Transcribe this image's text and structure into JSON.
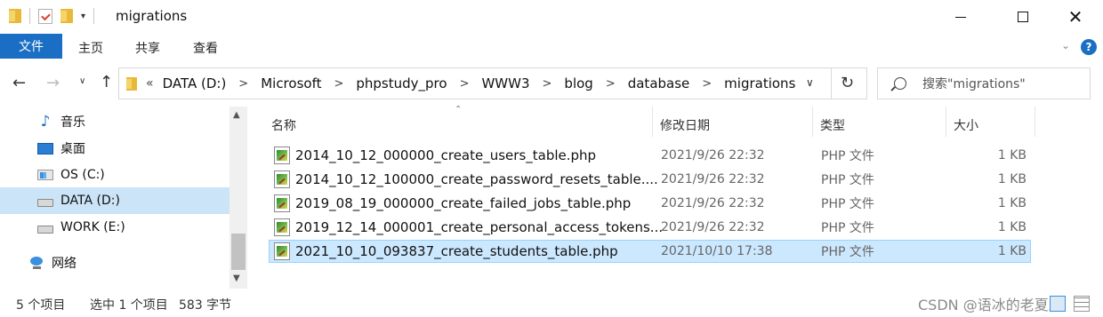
{
  "window": {
    "title": "migrations",
    "qat_dropdown": "▾",
    "minimize": "",
    "maximize": "",
    "close": "✕"
  },
  "ribbon": {
    "tabs": [
      {
        "label": "文件"
      },
      {
        "label": "主页"
      },
      {
        "label": "共享"
      },
      {
        "label": "查看"
      }
    ],
    "expand": "⌄",
    "help": "?"
  },
  "nav": {
    "back": "←",
    "forward": "→",
    "recent": "∨",
    "up": "↑",
    "overflow": "«",
    "breadcrumbs": [
      "DATA (D:)",
      "Microsoft",
      "phpstudy_pro",
      "WWW3",
      "blog",
      "database",
      "migrations"
    ],
    "separator": ">",
    "dropdown": "∨",
    "refresh": "↻",
    "search_placeholder": "搜索\"migrations\""
  },
  "sidebar": {
    "items": [
      {
        "label": "音乐",
        "icon": "music-note-icon",
        "selected": false
      },
      {
        "label": "桌面",
        "icon": "desktop-icon",
        "selected": false
      },
      {
        "label": "OS (C:)",
        "icon": "os-drive-icon",
        "selected": false
      },
      {
        "label": "DATA (D:)",
        "icon": "drive-icon",
        "selected": true
      },
      {
        "label": "WORK (E:)",
        "icon": "drive-icon",
        "selected": false
      },
      {
        "label": "网络",
        "icon": "network-icon",
        "selected": false
      }
    ],
    "scroll_up": "▲",
    "scroll_down": "▼"
  },
  "filelist": {
    "sort_indicator": "⌃",
    "columns": {
      "name": "名称",
      "date": "修改日期",
      "type": "类型",
      "size": "大小"
    },
    "rows": [
      {
        "name": "2014_10_12_000000_create_users_table.php",
        "date": "2021/9/26 22:32",
        "type": "PHP 文件",
        "size": "1 KB",
        "selected": false
      },
      {
        "name": "2014_10_12_100000_create_password_resets_table....",
        "date": "2021/9/26 22:32",
        "type": "PHP 文件",
        "size": "1 KB",
        "selected": false
      },
      {
        "name": "2019_08_19_000000_create_failed_jobs_table.php",
        "date": "2021/9/26 22:32",
        "type": "PHP 文件",
        "size": "1 KB",
        "selected": false
      },
      {
        "name": "2019_12_14_000001_create_personal_access_tokens...",
        "date": "2021/9/26 22:32",
        "type": "PHP 文件",
        "size": "1 KB",
        "selected": false
      },
      {
        "name": "2021_10_10_093837_create_students_table.php",
        "date": "2021/10/10 17:38",
        "type": "PHP 文件",
        "size": "1 KB",
        "selected": true
      }
    ]
  },
  "status": {
    "count": "5 个项目",
    "selection": "选中 1 个项目",
    "size": "583 字节",
    "watermark": "CSDN @语冰的老夏虫"
  },
  "colors": {
    "accent": "#1a6fc4",
    "selection": "#cce8ff",
    "selection_border": "#99d1ff",
    "sidebar_selection": "#cce4f7"
  }
}
